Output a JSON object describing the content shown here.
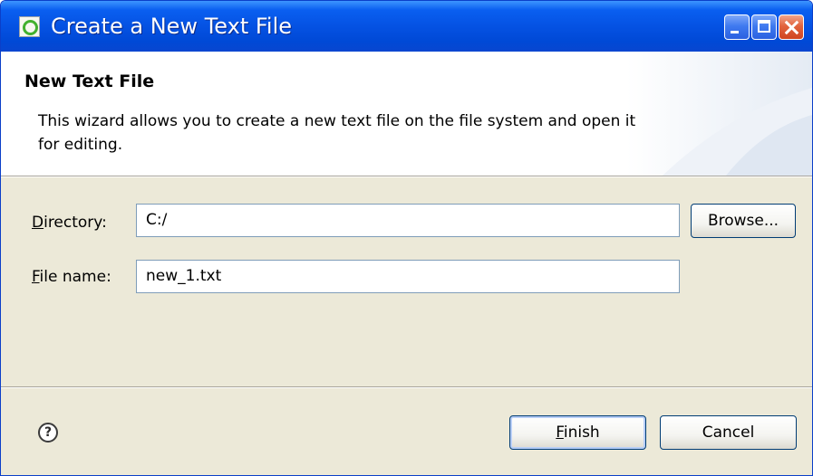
{
  "window": {
    "title": "Create a New Text File"
  },
  "banner": {
    "title": "New Text File",
    "description": "This wizard allows you to create a new text file on the file system and open it for editing."
  },
  "form": {
    "directory": {
      "label_mnemonic": "D",
      "label_rest": "irectory:",
      "value": "C:/"
    },
    "file_name": {
      "label_mnemonic": "F",
      "label_rest": "ile name:",
      "value": "new_1.txt"
    },
    "browse_label": "Browse..."
  },
  "footer": {
    "help_glyph": "?",
    "finish_mnemonic": "F",
    "finish_rest": "inish",
    "cancel_label": "Cancel"
  },
  "icons": {
    "app": "eclipse-green-ring-icon",
    "help": "question-circle-icon",
    "minimize": "minimize-icon",
    "maximize": "maximize-icon",
    "close": "close-icon"
  },
  "colors": {
    "title_bar": "#0552e3",
    "close_button": "#e2643e",
    "dialog_background": "#ece9d8",
    "field_border": "#7f9db9"
  }
}
